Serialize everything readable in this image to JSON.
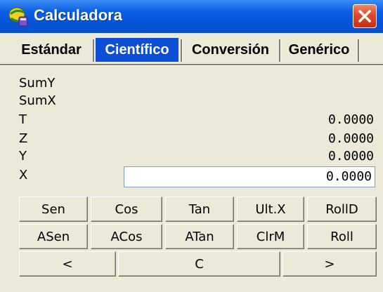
{
  "window": {
    "title": "Calculadora",
    "close_label": "✕"
  },
  "tabs": [
    {
      "label": "Estándar",
      "active": false
    },
    {
      "label": "Científico",
      "active": true
    },
    {
      "label": "Conversión",
      "active": false
    },
    {
      "label": "Genérico",
      "active": false
    }
  ],
  "stack": {
    "sumy_label": "SumY",
    "sumx_label": "SumX",
    "t_label": "T",
    "t_value": "0.0000",
    "z_label": "Z",
    "z_value": "0.0000",
    "y_label": "Y",
    "y_value": "0.0000",
    "x_label": "X",
    "x_value": "0.0000"
  },
  "buttons": {
    "row1": [
      "Sen",
      "Cos",
      "Tan",
      "Ult.X",
      "RollD"
    ],
    "row2": [
      "ASen",
      "ACos",
      "ATan",
      "ClrM",
      "Roll"
    ],
    "row3": [
      "<",
      "C",
      ">"
    ]
  },
  "colors": {
    "titlebar": "#0554d8",
    "active_tab": "#0c4fd6",
    "close_button": "#e0492a",
    "background": "#ece9d8"
  },
  "icons": {
    "app": "calculator-app-icon",
    "close": "close-icon"
  }
}
